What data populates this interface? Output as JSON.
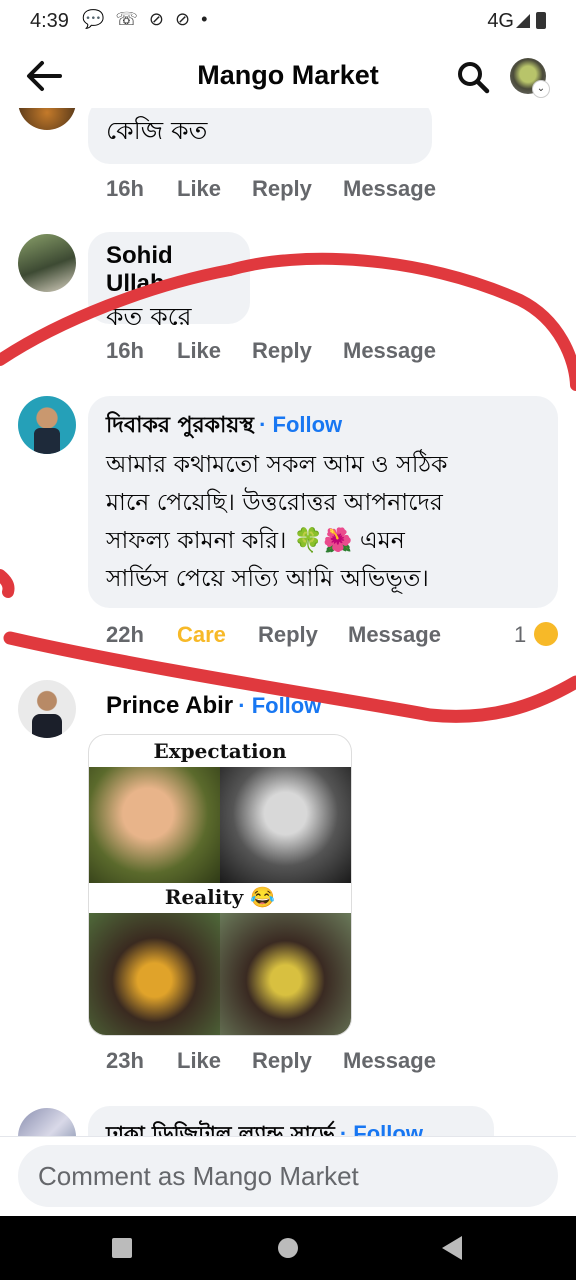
{
  "status_bar": {
    "time": "4:39",
    "notifications": "💬 ☏ ⊘ ⊘ •",
    "network": "4G"
  },
  "header": {
    "title": "Mango Market"
  },
  "comments": [
    {
      "body": "কেজি কত",
      "time": "16h",
      "like": "Like",
      "reply": "Reply",
      "message": "Message"
    },
    {
      "author": "Sohid Ullah",
      "body": "কত করে",
      "time": "16h",
      "like": "Like",
      "reply": "Reply",
      "message": "Message"
    },
    {
      "author": "দিবাকর পুরকায়স্থ",
      "follow": "· Follow",
      "body_lines": [
        "আমার কথামতো সকল আম ও সঠিক",
        "মানে পেয়েছি। উত্তরোত্তর আপনাদের",
        "সাফল্য কামনা করি। 🍀🌺 এমন",
        "সার্ভিস পেয়ে সত্যি আমি অভিভূত।"
      ],
      "time": "22h",
      "reaction": "Care",
      "reply": "Reply",
      "message": "Message",
      "reaction_count": "1"
    },
    {
      "author": "Prince Abir",
      "follow": "· Follow",
      "meme": {
        "top_caption": "Expectation",
        "bottom_caption": "Reality 😂"
      },
      "time": "23h",
      "like": "Like",
      "reply": "Reply",
      "message": "Message"
    },
    {
      "author": "ঢাকা ডিজিটাল ল্যান্ড সার্ভে",
      "follow": "· Follow"
    }
  ],
  "composer": {
    "placeholder": "Comment as Mango Market"
  },
  "colors": {
    "follow": "#1877f2",
    "care": "#f7b928",
    "bubble": "#f0f2f5",
    "annotation": "#e0393e"
  }
}
